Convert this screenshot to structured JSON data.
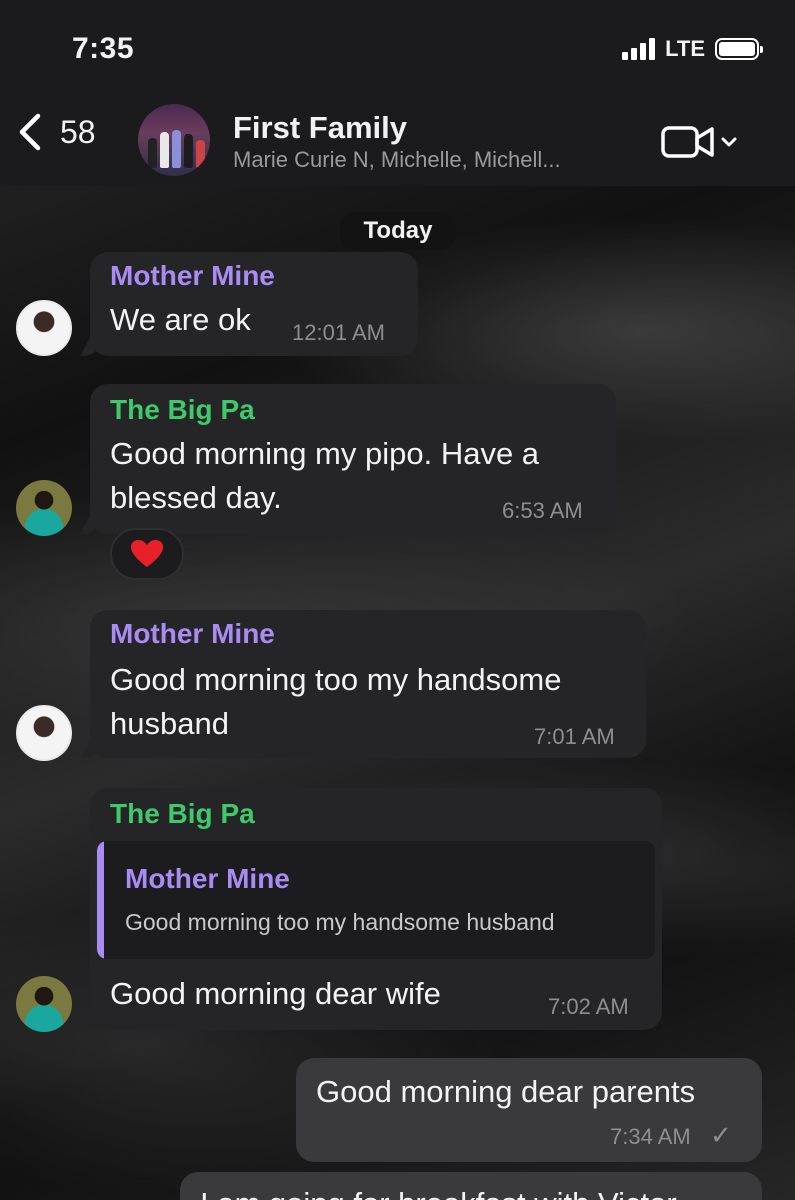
{
  "status_bar": {
    "time": "7:35",
    "network": "LTE"
  },
  "header": {
    "back_count": "58",
    "title": "First Family",
    "subtitle": "Marie Curie N, Michelle, Michell..."
  },
  "date_divider": "Today",
  "messages": [
    {
      "sender": "Mother Mine",
      "lines": [
        "We are ok"
      ],
      "time": "12:01 AM"
    },
    {
      "sender": "The Big Pa",
      "lines": [
        "Good morning my pipo. Have a",
        "blessed day."
      ],
      "time": "6:53 AM",
      "reaction": "❤️"
    },
    {
      "sender": "Mother Mine",
      "lines": [
        "Good morning too my handsome",
        "husband"
      ],
      "time": "7:01 AM"
    },
    {
      "sender": "The Big Pa",
      "reply_to": {
        "sender": "Mother Mine",
        "text": "Good morning too my handsome husband"
      },
      "lines": [
        "Good morning dear wife"
      ],
      "time": "7:02 AM"
    },
    {
      "outgoing": true,
      "lines": [
        "Good morning dear parents"
      ],
      "time": "7:34 AM",
      "status": "✓"
    },
    {
      "outgoing": true,
      "lines": [
        "I am going for breakfast with Victor"
      ]
    }
  ],
  "colors": {
    "mother_name": "#a98bf3",
    "pa_name": "#3ec96a",
    "incoming_bubble": "#252527",
    "outgoing_bubble": "#3a3a3c"
  }
}
